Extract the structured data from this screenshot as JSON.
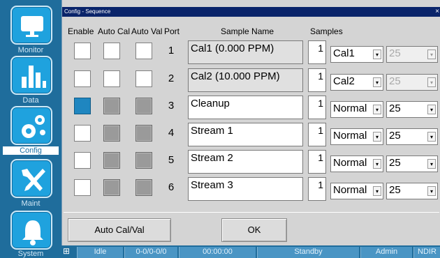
{
  "sidebar": {
    "items": [
      {
        "label": "Monitor",
        "icon": "monitor-icon"
      },
      {
        "label": "Data",
        "icon": "bar-chart-icon"
      },
      {
        "label": "Config",
        "icon": "gears-icon",
        "active": true
      },
      {
        "label": "Maint",
        "icon": "tools-icon"
      },
      {
        "label": "System",
        "icon": "bell-icon"
      }
    ]
  },
  "window": {
    "title": "Config - Sequence",
    "close": "×"
  },
  "headers": {
    "enable": "Enable",
    "auto_cal": "Auto Cal",
    "auto_val": "Auto Val",
    "port": "Port",
    "sample_name": "Sample Name",
    "samples": "Samples"
  },
  "rows": [
    {
      "port": "1",
      "name": "Cal1 (0.000 PPM)",
      "count": "1",
      "mode": "Cal1",
      "value": "25",
      "enable": false,
      "value_disabled": true,
      "readonly": true
    },
    {
      "port": "2",
      "name": "Cal2 (10.000 PPM)",
      "count": "1",
      "mode": "Cal2",
      "value": "25",
      "enable": false,
      "value_disabled": true,
      "readonly": true
    },
    {
      "port": "3",
      "name": "Cleanup",
      "count": "1",
      "mode": "Normal",
      "value": "25",
      "enable": true,
      "value_disabled": false,
      "readonly": false
    },
    {
      "port": "4",
      "name": "Stream 1",
      "count": "1",
      "mode": "Normal",
      "value": "25",
      "enable": false,
      "value_disabled": false,
      "readonly": false
    },
    {
      "port": "5",
      "name": "Stream 2",
      "count": "1",
      "mode": "Normal",
      "value": "25",
      "enable": false,
      "value_disabled": false,
      "readonly": false
    },
    {
      "port": "6",
      "name": "Stream 3",
      "count": "1",
      "mode": "Normal",
      "value": "25",
      "enable": false,
      "value_disabled": false,
      "readonly": false
    }
  ],
  "buttons": {
    "auto_cal_val": "Auto Cal/Val",
    "ok": "OK"
  },
  "status": {
    "state": "Idle",
    "counts": "0-0/0-0/0",
    "time": "00:00:00",
    "mode": "Standby",
    "user": "Admin",
    "detector": "NDIR"
  },
  "colors": {
    "sidebar": "#1f6d9c",
    "nav_button": "#1fa2de",
    "title_bar": "#0a246a",
    "enabled_check": "#1f86c0"
  }
}
